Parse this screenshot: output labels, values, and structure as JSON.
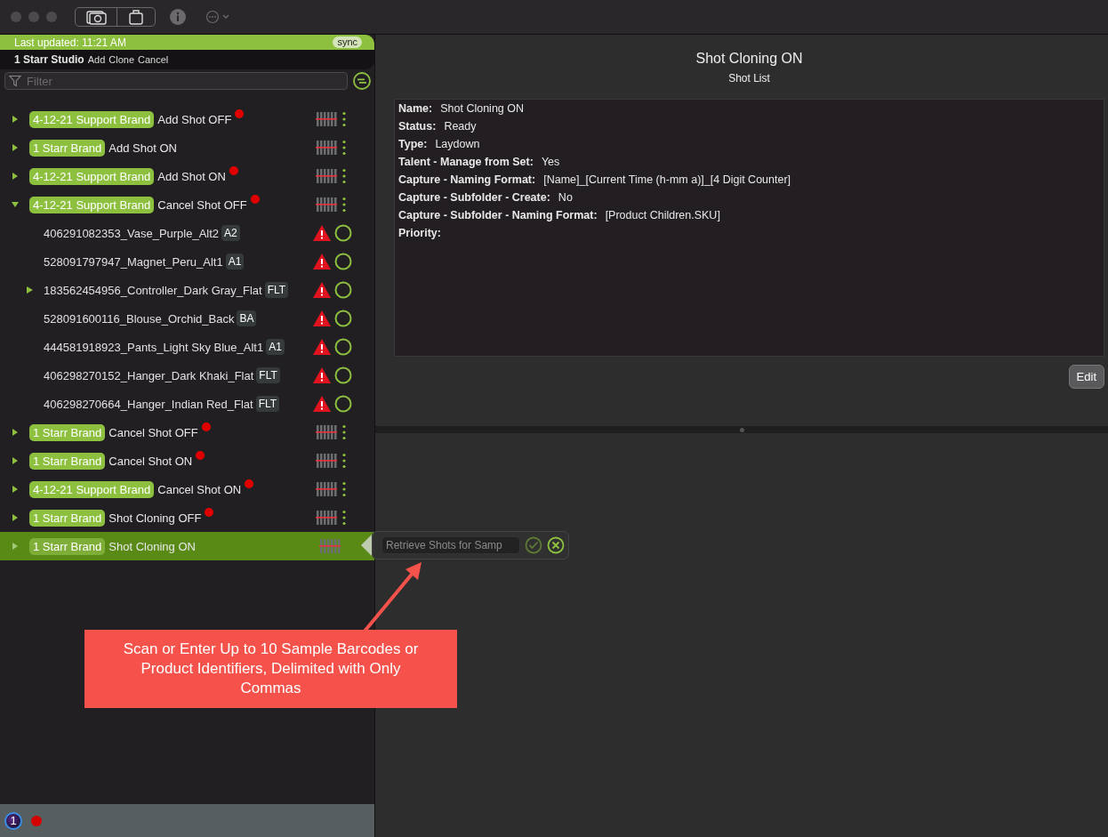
{
  "header": {
    "last_updated": "Last updated: 11:21 AM",
    "sync": "sync",
    "studio": "1 Starr Studio",
    "actions": [
      "Add",
      "Clone",
      "Cancel"
    ]
  },
  "filter": {
    "placeholder": "Filter"
  },
  "shots": [
    {
      "brand": "4-12-21 Support Brand",
      "name": "Add Shot OFF",
      "flagged": true,
      "expanded": false,
      "selected": false
    },
    {
      "brand": "1 Starr Brand",
      "name": "Add Shot ON",
      "flagged": false,
      "expanded": false,
      "selected": false
    },
    {
      "brand": "4-12-21 Support Brand",
      "name": "Add Shot ON",
      "flagged": true,
      "expanded": false,
      "selected": false
    },
    {
      "brand": "4-12-21 Support Brand",
      "name": "Cancel Shot OFF",
      "flagged": true,
      "expanded": true,
      "selected": false,
      "children": [
        {
          "name": "406291082353_Vase_Purple_Alt2",
          "badge": "A2",
          "expandable": false
        },
        {
          "name": "528091797947_Magnet_Peru_Alt1",
          "badge": "A1",
          "expandable": false
        },
        {
          "name": "183562454956_Controller_Dark Gray_Flat",
          "badge": "FLT",
          "expandable": true
        },
        {
          "name": "528091600116_Blouse_Orchid_Back",
          "badge": "BA",
          "expandable": false
        },
        {
          "name": "444581918923_Pants_Light Sky Blue_Alt1",
          "badge": "A1",
          "expandable": false
        },
        {
          "name": "406298270152_Hanger_Dark Khaki_Flat",
          "badge": "FLT",
          "expandable": false
        },
        {
          "name": "406298270664_Hanger_Indian Red_Flat",
          "badge": "FLT",
          "expandable": false
        }
      ]
    },
    {
      "brand": "1 Starr Brand",
      "name": "Cancel Shot OFF",
      "flagged": true,
      "expanded": false,
      "selected": false
    },
    {
      "brand": "1 Starr Brand",
      "name": "Cancel Shot ON",
      "flagged": true,
      "expanded": false,
      "selected": false
    },
    {
      "brand": "4-12-21 Support Brand",
      "name": "Cancel Shot ON",
      "flagged": true,
      "expanded": false,
      "selected": false
    },
    {
      "brand": "1 Starr Brand",
      "name": "Shot Cloning OFF",
      "flagged": true,
      "expanded": false,
      "selected": false
    },
    {
      "brand": "1 Starr Brand",
      "name": "Shot Cloning ON",
      "flagged": false,
      "expanded": false,
      "selected": true
    }
  ],
  "popover": {
    "placeholder": "Retrieve Shots for Samp"
  },
  "detail": {
    "title": "Shot Cloning ON",
    "subtitle": "Shot List",
    "fields": [
      {
        "label": "Name:",
        "value": "Shot Cloning ON"
      },
      {
        "label": "Status:",
        "value": "Ready"
      },
      {
        "label": "Type:",
        "value": "Laydown"
      },
      {
        "label": "Talent - Manage from Set:",
        "value": "Yes"
      },
      {
        "label": "Capture - Naming Format:",
        "value": "[Name]_[Current Time (h-mm a)]_[4 Digit Counter]"
      },
      {
        "label": "Capture - Subfolder - Create:",
        "value": "No"
      },
      {
        "label": "Capture - Subfolder - Naming Format:",
        "value": "[Product Children.SKU]"
      },
      {
        "label": "Priority:"
      }
    ],
    "edit": "Edit"
  },
  "annotation": {
    "text": "Scan or Enter Up to 10 Sample Barcodes or Product Identifiers, Delimited with Only Commas"
  },
  "status_bar": {
    "badge": "1"
  }
}
